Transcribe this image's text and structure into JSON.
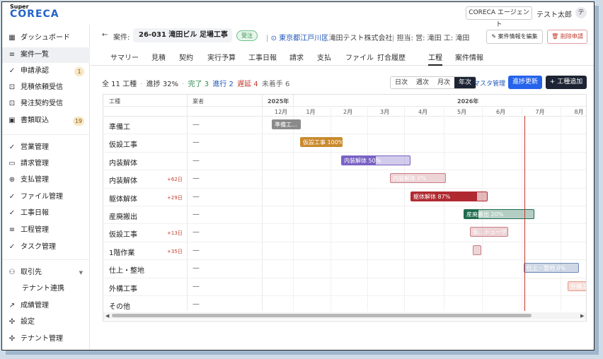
{
  "app": {
    "logo_super": "Super",
    "logo_main": "CORECA",
    "agent_button": "CORECA エージェント",
    "user_name": "テスト太郎",
    "avatar_initial": "テ"
  },
  "sidebar": {
    "items": [
      {
        "label": "ダッシュボード",
        "icon": "grid-icon",
        "glyph": "▦"
      },
      {
        "label": "案件一覧",
        "icon": "list-icon",
        "glyph": "≡",
        "active": true
      },
      {
        "label": "申請承認",
        "icon": "check-icon",
        "glyph": "✓",
        "badge": "1"
      },
      {
        "label": "見積依頼受信",
        "icon": "inbox-icon",
        "glyph": "⊡"
      },
      {
        "label": "発注契約受信",
        "icon": "inbox-icon",
        "glyph": "⊡"
      },
      {
        "label": "書類取込",
        "icon": "document-icon",
        "glyph": "▣",
        "badge": "19"
      },
      {
        "label": "営業管理",
        "icon": "check-icon",
        "glyph": "✓"
      },
      {
        "label": "請求管理",
        "icon": "card-icon",
        "glyph": "▭"
      },
      {
        "label": "支払管理",
        "icon": "plus-circle-icon",
        "glyph": "⊕"
      },
      {
        "label": "ファイル管理",
        "icon": "check-icon",
        "glyph": "✓"
      },
      {
        "label": "工事日報",
        "icon": "check-icon",
        "glyph": "✓"
      },
      {
        "label": "工程管理",
        "icon": "list-icon",
        "glyph": "≡"
      },
      {
        "label": "タスク管理",
        "icon": "check-icon",
        "glyph": "✓"
      },
      {
        "label": "取引先",
        "icon": "users-icon",
        "glyph": "⚇"
      },
      {
        "label": "テナント連携",
        "icon": "",
        "glyph": ""
      },
      {
        "label": "成績管理",
        "icon": "trend-icon",
        "glyph": "↗"
      },
      {
        "label": "設定",
        "icon": "gear-icon",
        "glyph": "✣"
      },
      {
        "label": "テナント管理",
        "icon": "gear-icon",
        "glyph": "✣"
      }
    ]
  },
  "header": {
    "back": "←",
    "case_label": "案件:",
    "project": "26-031 滝田ビル 足場工事",
    "status": "受注",
    "location": "東京都江戸川区",
    "client": "滝田テスト株式会社",
    "staff": "担当: 営: 滝田 工: 滝田",
    "edit_button": "案件情報を編集",
    "delete_button": "削除申請"
  },
  "tabs": [
    "サマリー",
    "見積",
    "契約",
    "実行予算",
    "工事日報",
    "請求",
    "支払",
    "ファイル",
    "打合履歴",
    "工程",
    "案件情報"
  ],
  "active_tab": "工程",
  "summary": {
    "total": "全 11 工種",
    "progress": "進捗 32%",
    "done": "完了 3",
    "running": "進行 2",
    "delayed": "遅延 4",
    "notstarted": "未着手 6"
  },
  "view_buttons": [
    "日次",
    "週次",
    "月次",
    "年次"
  ],
  "active_view": "年次",
  "master_link": "マスタ管理",
  "progress_update_button": "進捗更新",
  "add_task_button": "+ 工種追加",
  "gantt": {
    "col_task": "工種",
    "col_vendor": "業者",
    "years": [
      "2025年",
      "2026年"
    ],
    "months": [
      "12月",
      "1月",
      "2月",
      "3月",
      "4月",
      "5月",
      "6月",
      "7月",
      "8月"
    ],
    "rows": [
      {
        "name": "準備工",
        "delay": "",
        "vendor": "—",
        "label": "準備工…",
        "color": "#8a8a8a"
      },
      {
        "name": "仮設工事",
        "delay": "",
        "vendor": "—",
        "label": "仮設工事 100%",
        "color": "#c98a2e"
      },
      {
        "name": "内装解体",
        "delay": "",
        "vendor": "—",
        "label": "内装解体 50%",
        "color": "#7a62c4"
      },
      {
        "name": "内装解体",
        "delay": "+62日",
        "vendor": "—",
        "label": "内装解体 0%",
        "color": "#c87d85"
      },
      {
        "name": "躯体解体",
        "delay": "+29日",
        "vendor": "—",
        "label": "躯体解体 87%",
        "color": "#b02a30"
      },
      {
        "name": "産廃搬出",
        "delay": "",
        "vendor": "—",
        "label": "産廃搬出 20%",
        "color": "#1f6b4f"
      },
      {
        "name": "仮設工事",
        "delay": "+13日",
        "vendor": "—",
        "label": "仮…トューザ",
        "color": "#c87d85"
      },
      {
        "name": "1階作業",
        "delay": "+35日",
        "vendor": "—",
        "label": "",
        "color": "#c87d85"
      },
      {
        "name": "仕上・整地",
        "delay": "",
        "vendor": "—",
        "label": "仕上・整地 0%",
        "color": "#6f8ab5"
      },
      {
        "name": "外構工事",
        "delay": "",
        "vendor": "—",
        "label": "外構工",
        "color": "#e39a86"
      },
      {
        "name": "その他",
        "delay": "",
        "vendor": "—",
        "label": "",
        "color": ""
      }
    ]
  }
}
